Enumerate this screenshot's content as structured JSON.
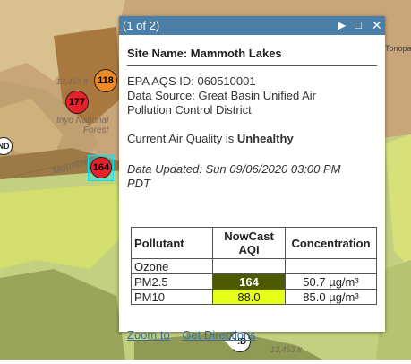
{
  "map": {
    "labels": [
      "13,453 ft",
      "Inyo National",
      "Forest",
      "Mountains",
      "Tonopah",
      "13,453 ft"
    ],
    "markers": [
      {
        "label": "118",
        "color": "#f08a24"
      },
      {
        "label": "177",
        "color": "#e8212a"
      },
      {
        "label": "164",
        "color": "#e8212a"
      },
      {
        "label": "ND",
        "color": "#ffffff"
      },
      {
        "label": "ND",
        "color": "#ffffff"
      }
    ],
    "colors": {
      "bg_tan": "#c9a57a",
      "bg_brown": "#a9783f",
      "bg_olive": "#b8c97a",
      "bg_yellowgreen": "#d2df6c",
      "selection": "#00e5ff"
    }
  },
  "popup": {
    "pager": "(1 of 2)",
    "site_name": "Site Name: Mammoth Lakes",
    "aqs_id": "EPA AQS ID: 060510001",
    "source_line1": "Data Source: Great Basin Unified Air",
    "source_line2": "Pollution Control District",
    "air_quality_prefix": "Current Air Quality is ",
    "air_quality_value": "Unhealthy",
    "updated_line1": "Data Updated: Sun 09/06/2020 03:00 PM",
    "updated_line2": "PDT",
    "table": {
      "headers": [
        "Pollutant",
        "NowCast AQI",
        "Concentration"
      ],
      "rows": [
        {
          "pollutant": "Ozone",
          "aqi": "",
          "concentration": "",
          "color": "#ffffff",
          "text_color": "#222222"
        },
        {
          "pollutant": "PM2.5",
          "aqi": "164",
          "concentration": "50.7 µg/m³",
          "color": "#4e5a00",
          "text_color": "#ffffff"
        },
        {
          "pollutant": "PM10",
          "aqi": "88.0",
          "concentration": "85.0 µg/m³",
          "color": "#e6ff1a",
          "text_color": "#222222"
        }
      ]
    },
    "zoom_to": "Zoom to",
    "get_directions": "Get Directions",
    "header_color": "#4c7fa8"
  }
}
